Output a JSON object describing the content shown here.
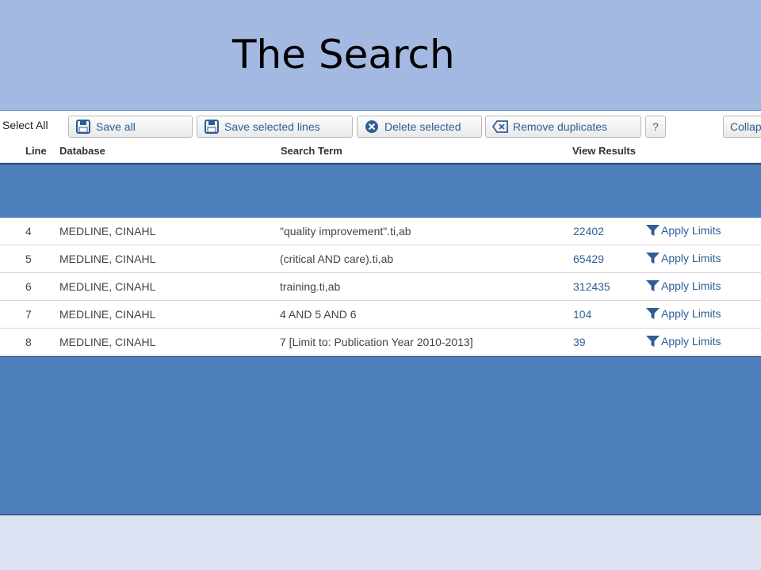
{
  "slide": {
    "title": "The Search"
  },
  "toolbar": {
    "select_all": "Select All",
    "save_all": "Save all",
    "save_selected": "Save selected lines",
    "delete_selected": "Delete selected",
    "remove_duplicates": "Remove duplicates",
    "help": "?",
    "collapse": "Collap"
  },
  "columns": {
    "line": "Line",
    "database": "Database",
    "term": "Search Term",
    "results": "View Results"
  },
  "rows": [
    {
      "line": "4",
      "database": "MEDLINE, CINAHL",
      "term": "\"quality improvement\".ti,ab",
      "results": "22402",
      "limits": "Apply Limits"
    },
    {
      "line": "5",
      "database": "MEDLINE, CINAHL",
      "term": "(critical AND care).ti,ab",
      "results": "65429",
      "limits": "Apply Limits"
    },
    {
      "line": "6",
      "database": "MEDLINE, CINAHL",
      "term": "training.ti,ab",
      "results": "312435",
      "limits": "Apply Limits"
    },
    {
      "line": "7",
      "database": "MEDLINE, CINAHL",
      "term": "4 AND 5 AND 6",
      "results": "104",
      "limits": "Apply Limits"
    },
    {
      "line": "8",
      "database": "MEDLINE, CINAHL",
      "term": "7 [Limit to: Publication Year 2010-2013]",
      "results": "39",
      "limits": "Apply Limits"
    }
  ],
  "colors": {
    "slide_bg": "#a3b9e1",
    "panel_blue": "#4f80be",
    "link_blue": "#2f5e94"
  },
  "icons": [
    "save-icon",
    "delete-icon",
    "remove-duplicates-icon",
    "filter-icon"
  ]
}
